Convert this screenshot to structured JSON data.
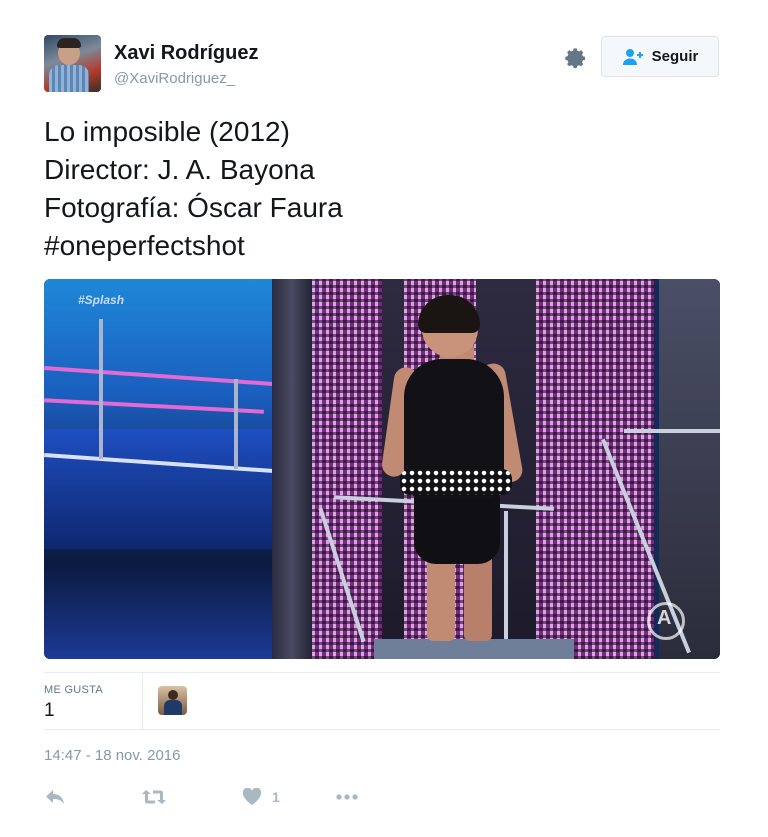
{
  "author": {
    "name": "Xavi Rodríguez",
    "handle": "@XaviRodriguez_"
  },
  "follow_button": {
    "label": "Seguir"
  },
  "tweet": {
    "lines": [
      "Lo imposible (2012)",
      "Director: J. A. Bayona",
      "Fotografía: Óscar Faura",
      "#oneperfectshot"
    ]
  },
  "media": {
    "overlay_tag": "#Splash"
  },
  "stats": {
    "likes_label": "ME GUSTA",
    "likes_count": "1"
  },
  "timestamp": "14:47 - 18 nov. 2016",
  "actions": {
    "like_count": "1",
    "icons": [
      "reply-icon",
      "retweet-icon",
      "heart-icon",
      "more-icon"
    ]
  },
  "colors": {
    "text": "#14171a",
    "secondary": "#8899a6",
    "action_gray": "#aab8c2",
    "divider": "#e6ecf0",
    "follow_bg": "#f5f8fa",
    "follow_icon": "#1da1f2"
  }
}
